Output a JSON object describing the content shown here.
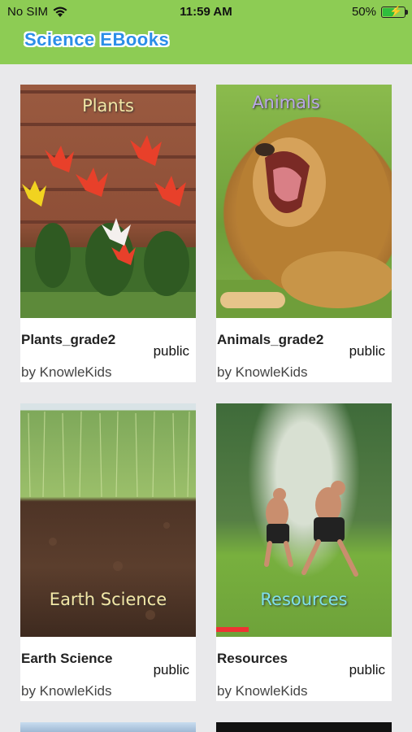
{
  "status_bar": {
    "carrier": "No SIM",
    "time": "11:59 AM",
    "battery": "50%"
  },
  "header": {
    "title": "Science EBooks"
  },
  "books": [
    {
      "cover_label": "Plants",
      "title": "Plants_grade2",
      "visibility": "public",
      "author": "by KnowleKids"
    },
    {
      "cover_label": "Animals",
      "title": "Animals_grade2",
      "visibility": "public",
      "author": "by KnowleKids"
    },
    {
      "cover_label": "Earth Science",
      "title": "Earth Science",
      "visibility": "public",
      "author": "by KnowleKids"
    },
    {
      "cover_label": "Resources",
      "title": "Resources",
      "visibility": "public",
      "author": "by KnowleKids"
    }
  ],
  "colors": {
    "header": "#8dcc54",
    "title": "#2c8ee8",
    "background": "#e9e9eb"
  }
}
